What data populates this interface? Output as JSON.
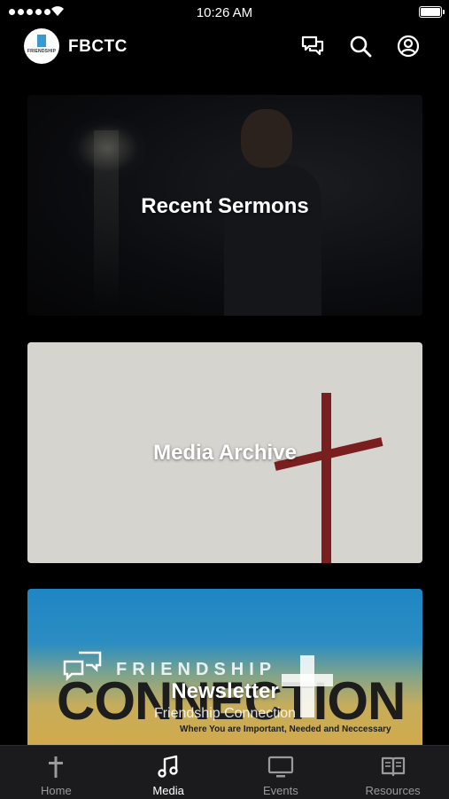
{
  "status_bar": {
    "time": "10:26 AM"
  },
  "header": {
    "app_title": "FBCTC",
    "logo_text": "FRIENDSHIP",
    "icons": [
      "chat-icon",
      "search-icon",
      "account-icon"
    ]
  },
  "cards": [
    {
      "title": "Recent Sermons"
    },
    {
      "title": "Media Archive"
    },
    {
      "title": "Newsletter",
      "subtitle": "Friendship Connection",
      "image_text": {
        "brand_small": "FRIENDSHIP",
        "brand_big": "CONNECTION",
        "tagline": "Where You are Important, Needed and Neccessary"
      }
    }
  ],
  "tab_bar": {
    "tabs": [
      {
        "label": "Home",
        "icon": "cross-icon",
        "active": false
      },
      {
        "label": "Media",
        "icon": "music-note-icon",
        "active": true
      },
      {
        "label": "Events",
        "icon": "monitor-icon",
        "active": false
      },
      {
        "label": "Resources",
        "icon": "book-icon",
        "active": false
      }
    ]
  },
  "colors": {
    "background": "#000000",
    "tab_bar": "#1b1b1d",
    "inactive_tab": "#9a9a9a"
  }
}
